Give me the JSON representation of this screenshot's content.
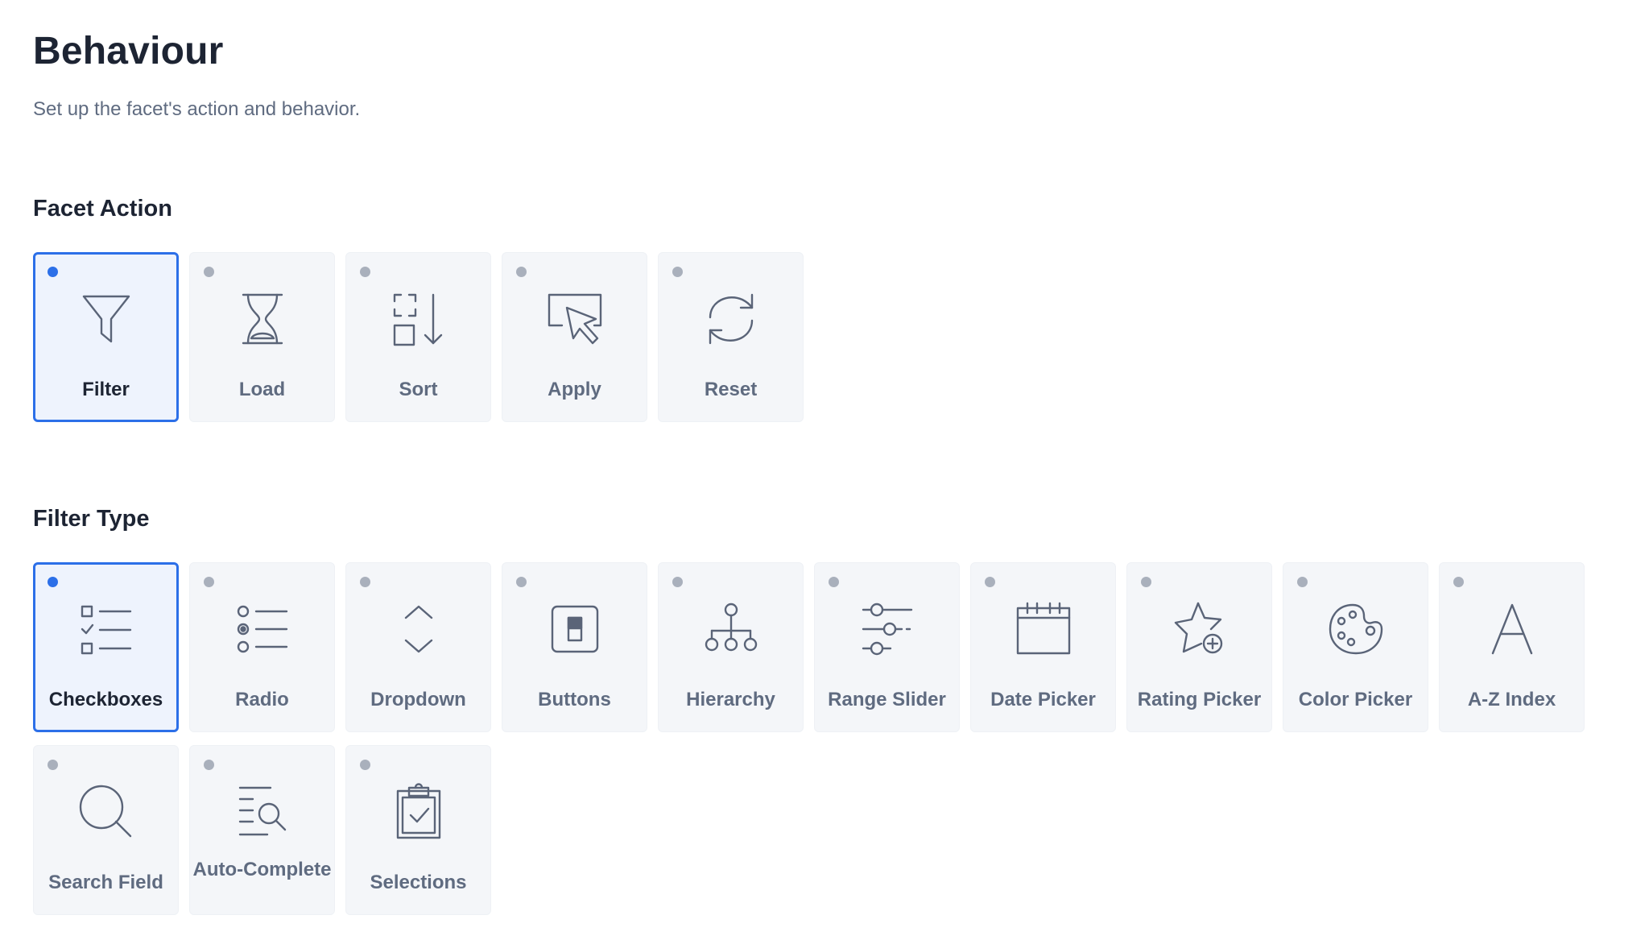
{
  "header": {
    "title": "Behaviour",
    "subtitle": "Set up the facet's action and behavior."
  },
  "facet_action": {
    "title": "Facet Action",
    "options": [
      {
        "label": "Filter",
        "icon": "filter-icon",
        "selected": true
      },
      {
        "label": "Load",
        "icon": "hourglass-icon",
        "selected": false
      },
      {
        "label": "Sort",
        "icon": "sort-icon",
        "selected": false
      },
      {
        "label": "Apply",
        "icon": "cursor-click-icon",
        "selected": false
      },
      {
        "label": "Reset",
        "icon": "refresh-icon",
        "selected": false
      }
    ]
  },
  "filter_type": {
    "title": "Filter Type",
    "options": [
      {
        "label": "Checkboxes",
        "icon": "checklist-icon",
        "selected": true
      },
      {
        "label": "Radio",
        "icon": "radio-list-icon",
        "selected": false
      },
      {
        "label": "Dropdown",
        "icon": "chevron-up-down-icon",
        "selected": false
      },
      {
        "label": "Buttons",
        "icon": "button-icon",
        "selected": false
      },
      {
        "label": "Hierarchy",
        "icon": "hierarchy-icon",
        "selected": false
      },
      {
        "label": "Range Slider",
        "icon": "sliders-icon",
        "selected": false
      },
      {
        "label": "Date Picker",
        "icon": "calendar-icon",
        "selected": false
      },
      {
        "label": "Rating Picker",
        "icon": "star-plus-icon",
        "selected": false
      },
      {
        "label": "Color Picker",
        "icon": "palette-icon",
        "selected": false
      },
      {
        "label": "A-Z Index",
        "icon": "letter-a-icon",
        "selected": false
      },
      {
        "label": "Search Field",
        "icon": "search-icon",
        "selected": false
      },
      {
        "label": "Auto-Complete",
        "icon": "list-search-icon",
        "selected": false
      },
      {
        "label": "Selections",
        "icon": "clipboard-check-icon",
        "selected": false
      }
    ]
  },
  "colors": {
    "accent": "#2c6fe8",
    "tile_bg": "#f4f6f9",
    "selected_bg": "#eef3fd",
    "text_dark": "#1d2433",
    "text_muted": "#5f6b80"
  }
}
